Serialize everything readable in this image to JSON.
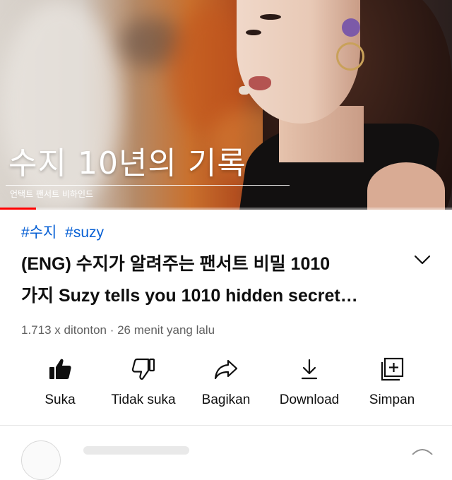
{
  "video": {
    "thumbnail_title": "수지 10년의 기록",
    "thumbnail_subtitle": "언택트 팬서트 비하인드",
    "progress": 0.08
  },
  "info": {
    "hashtags": [
      "#수지",
      "#suzy"
    ],
    "title_line1": "(ENG) 수지가 알려주는 팬서트 비밀 1010",
    "title_line2": "가지 Suzy tells you 1010 hidden secret…",
    "meta": "1.713 x ditonton · 26 menit yang lalu"
  },
  "actions": {
    "like": "Suka",
    "dislike": "Tidak suka",
    "share": "Bagikan",
    "download": "Download",
    "save": "Simpan"
  },
  "icons": {
    "expand": "chevron-down-icon",
    "like": "thumbs-up-icon",
    "dislike": "thumbs-down-icon",
    "share": "share-arrow-icon",
    "download": "download-icon",
    "save": "playlist-add-icon"
  },
  "colors": {
    "hashtag": "#065fd4",
    "progress": "#ff0000",
    "meta_text": "#606060"
  }
}
